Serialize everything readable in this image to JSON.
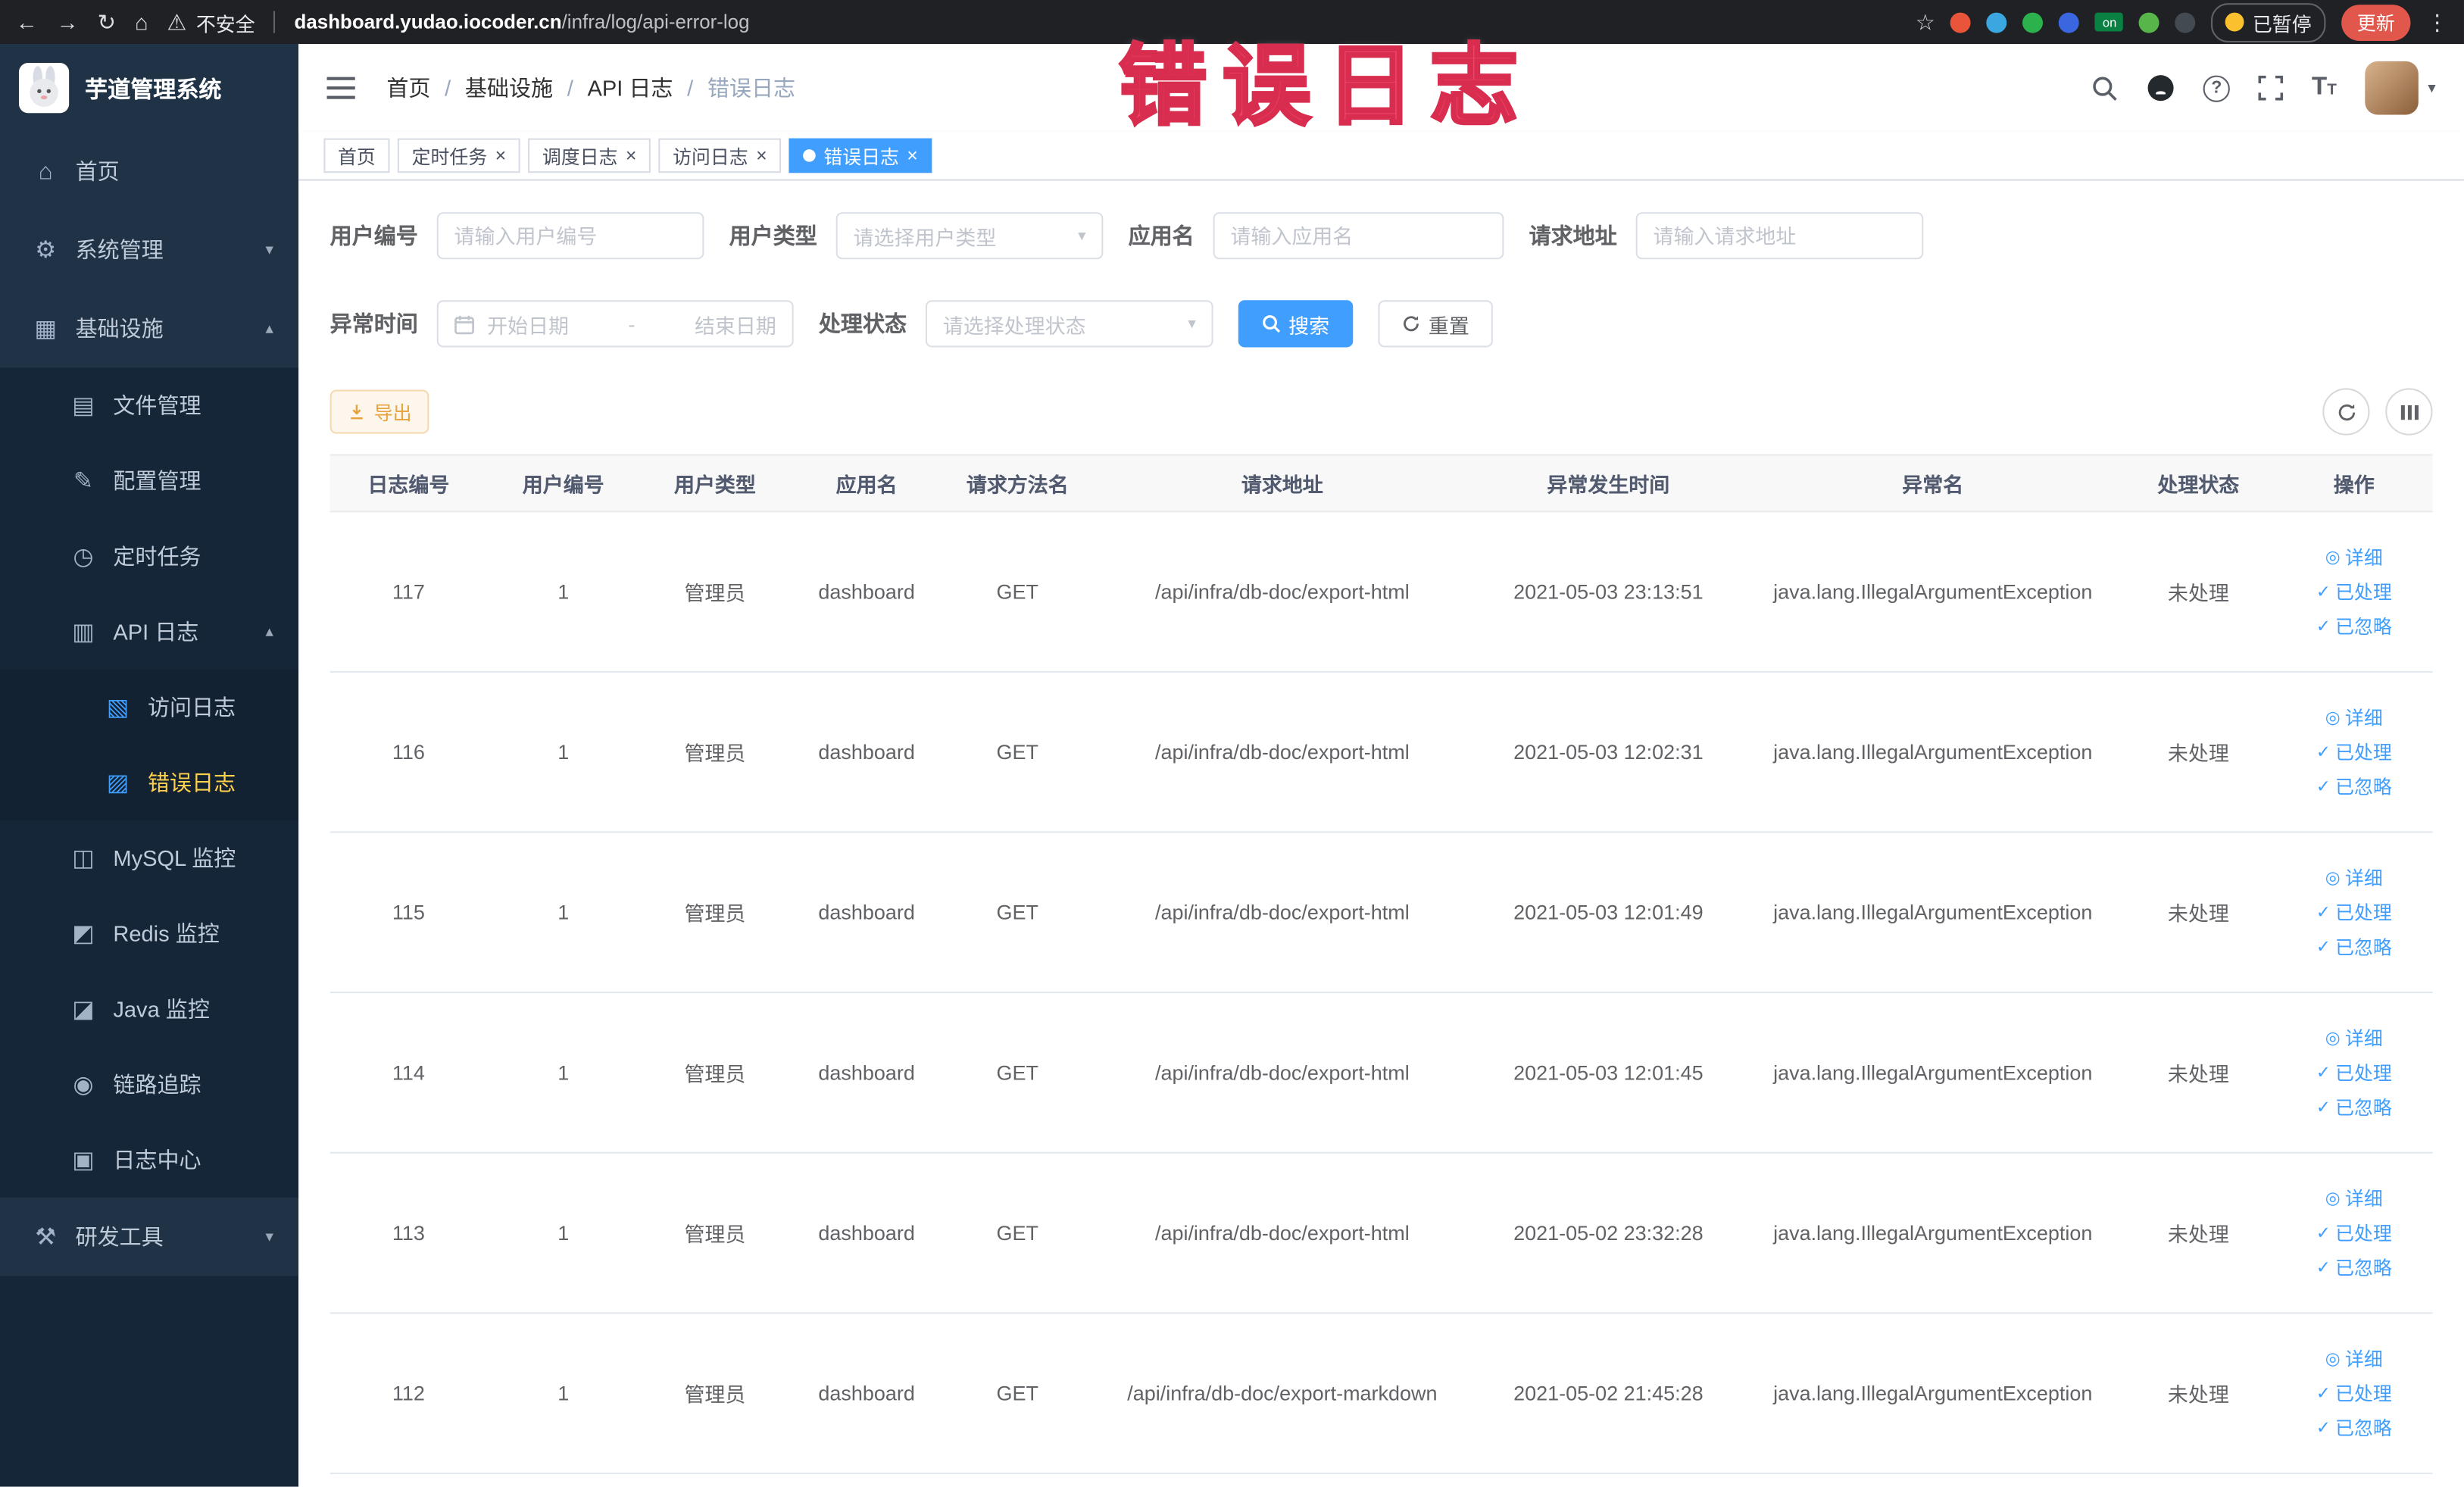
{
  "colors": {
    "accent": "#409eff",
    "active_menu_text": "#ffd04b",
    "warning": "#e6a23c",
    "annotation": "#f0476a",
    "sidebar_bg": "#1f3246",
    "submenu_bg": "#152638"
  },
  "icons": {
    "back": "←",
    "forward": "→",
    "reload": "↻",
    "browser_home": "⌂",
    "warning": "⚠",
    "star": "☆",
    "kebab": "⋮",
    "home": "⌂",
    "gear": "⚙",
    "components": "▦",
    "folder": "▤",
    "edit": "✎",
    "timer": "◷",
    "api_doc": "▥",
    "access_doc": "▧",
    "error_doc": "▨",
    "database": "◫",
    "redis": "◩",
    "java": "◪",
    "trace": "◉",
    "log_center": "▣",
    "tools": "⚒",
    "chevron_down": "▾",
    "chevron_up": "▴",
    "caret_down": "▾",
    "view": "◎",
    "check": "✓",
    "close": "×",
    "question": "?",
    "text_size": "T"
  },
  "browser": {
    "security_warning": "不安全",
    "url_domain": "dashboard.yudao.iocoder.cn",
    "url_path": "/infra/log/api-error-log",
    "on_badge": "on",
    "paused_badge": "已暂停",
    "update_button": "更新"
  },
  "annotation": {
    "text": "错误日志"
  },
  "sidebar": {
    "logo_title": "芋道管理系统",
    "items": [
      {
        "label": "首页"
      },
      {
        "label": "系统管理"
      },
      {
        "label": "基础设施"
      },
      {
        "label": "文件管理"
      },
      {
        "label": "配置管理"
      },
      {
        "label": "定时任务"
      },
      {
        "label": "API 日志"
      },
      {
        "label": "访问日志"
      },
      {
        "label": "错误日志"
      },
      {
        "label": "MySQL 监控"
      },
      {
        "label": "Redis 监控"
      },
      {
        "label": "Java 监控"
      },
      {
        "label": "链路追踪"
      },
      {
        "label": "日志中心"
      },
      {
        "label": "研发工具"
      }
    ]
  },
  "header": {
    "breadcrumb": [
      "首页",
      "基础设施",
      "API 日志",
      "错误日志"
    ],
    "breadcrumb_separator": "/"
  },
  "tabs": [
    {
      "label": "首页"
    },
    {
      "label": "定时任务"
    },
    {
      "label": "调度日志"
    },
    {
      "label": "访问日志"
    },
    {
      "label": "错误日志"
    }
  ],
  "filters": {
    "user_id_label": "用户编号",
    "user_id_placeholder": "请输入用户编号",
    "user_type_label": "用户类型",
    "user_type_placeholder": "请选择用户类型",
    "app_name_label": "应用名",
    "app_name_placeholder": "请输入应用名",
    "request_url_label": "请求地址",
    "request_url_placeholder": "请输入请求地址",
    "exception_time_label": "异常时间",
    "date_start_placeholder": "开始日期",
    "date_separator": "-",
    "date_end_placeholder": "结束日期",
    "process_status_label": "处理状态",
    "process_status_placeholder": "请选择处理状态",
    "search_button": "搜索",
    "reset_button": "重置"
  },
  "toolbar": {
    "export_button": "导出"
  },
  "table": {
    "columns": [
      "日志编号",
      "用户编号",
      "用户类型",
      "应用名",
      "请求方法名",
      "请求地址",
      "异常发生时间",
      "异常名",
      "处理状态",
      "操作"
    ],
    "actions": [
      "详细",
      "已处理",
      "已忽略"
    ],
    "rows": [
      {
        "id": "117",
        "user_id": "1",
        "user_type": "管理员",
        "app": "dashboard",
        "method": "GET",
        "url": "/api/infra/db-doc/export-html",
        "time": "2021-05-03 23:13:51",
        "exception": "java.lang.IllegalArgumentException",
        "status": "未处理"
      },
      {
        "id": "116",
        "user_id": "1",
        "user_type": "管理员",
        "app": "dashboard",
        "method": "GET",
        "url": "/api/infra/db-doc/export-html",
        "time": "2021-05-03 12:02:31",
        "exception": "java.lang.IllegalArgumentException",
        "status": "未处理"
      },
      {
        "id": "115",
        "user_id": "1",
        "user_type": "管理员",
        "app": "dashboard",
        "method": "GET",
        "url": "/api/infra/db-doc/export-html",
        "time": "2021-05-03 12:01:49",
        "exception": "java.lang.IllegalArgumentException",
        "status": "未处理"
      },
      {
        "id": "114",
        "user_id": "1",
        "user_type": "管理员",
        "app": "dashboard",
        "method": "GET",
        "url": "/api/infra/db-doc/export-html",
        "time": "2021-05-03 12:01:45",
        "exception": "java.lang.IllegalArgumentException",
        "status": "未处理"
      },
      {
        "id": "113",
        "user_id": "1",
        "user_type": "管理员",
        "app": "dashboard",
        "method": "GET",
        "url": "/api/infra/db-doc/export-html",
        "time": "2021-05-02 23:32:28",
        "exception": "java.lang.IllegalArgumentException",
        "status": "未处理"
      },
      {
        "id": "112",
        "user_id": "1",
        "user_type": "管理员",
        "app": "dashboard",
        "method": "GET",
        "url": "/api/infra/db-doc/export-markdown",
        "time": "2021-05-02 21:45:28",
        "exception": "java.lang.IllegalArgumentException",
        "status": "未处理"
      }
    ]
  }
}
